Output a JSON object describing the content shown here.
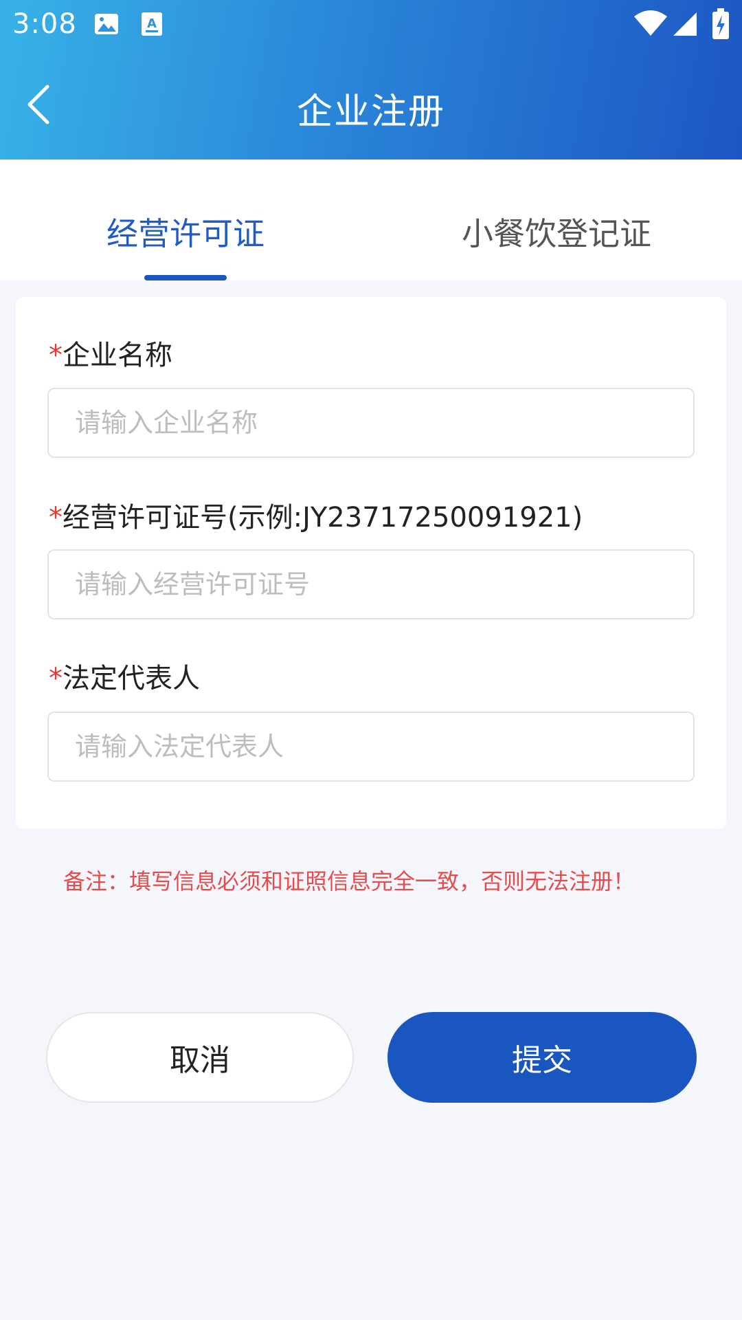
{
  "status_bar": {
    "time": "3:08",
    "icons": [
      "image-icon",
      "font-icon",
      "wifi-icon",
      "signal-icon",
      "battery-charging-icon"
    ]
  },
  "header": {
    "title": "企业注册",
    "back_icon": "chevron-left-icon"
  },
  "tabs": [
    {
      "label": "经营许可证",
      "active": true
    },
    {
      "label": "小餐饮登记证",
      "active": false
    }
  ],
  "form": {
    "fields": [
      {
        "required_mark": "*",
        "label": "企业名称",
        "placeholder": "请输入企业名称",
        "value": ""
      },
      {
        "required_mark": "*",
        "label": "经营许可证号(示例:JY23717250091921)",
        "placeholder": "请输入经营许可证号",
        "value": ""
      },
      {
        "required_mark": "*",
        "label": "法定代表人",
        "placeholder": "请输入法定代表人",
        "value": ""
      }
    ]
  },
  "note": "备注：填写信息必须和证照信息完全一致，否则无法注册！",
  "buttons": {
    "cancel": "取消",
    "submit": "提交"
  },
  "colors": {
    "primary": "#1a56c0",
    "header_gradient_start": "#38b2e6",
    "header_gradient_end": "#1d56c3",
    "required": "#e53935",
    "note": "#e84b4b",
    "background": "#f4f6fb"
  }
}
